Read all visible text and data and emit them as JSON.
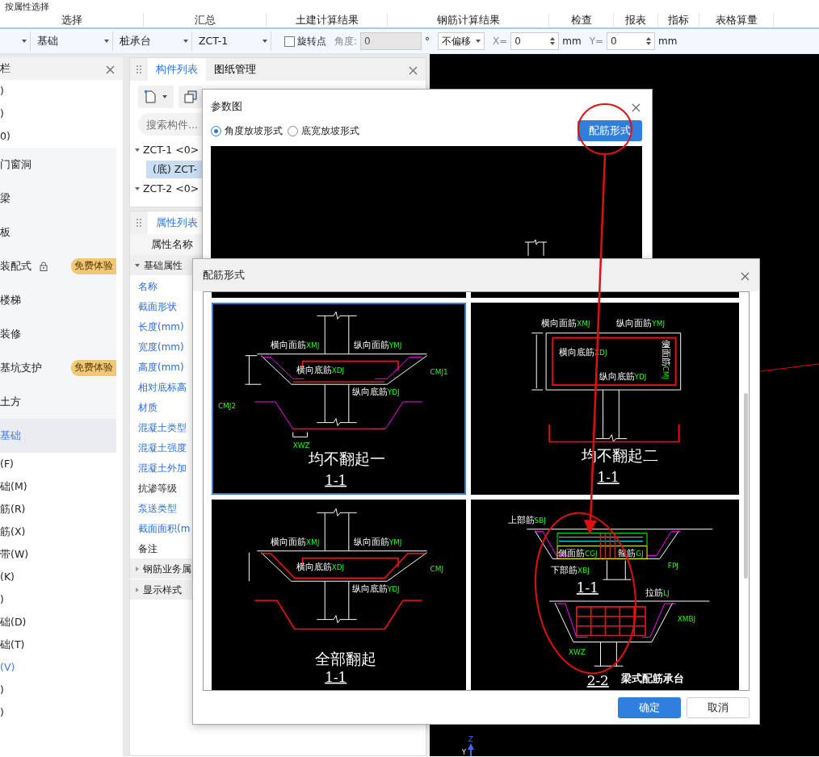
{
  "top_link": {
    "label": "按属性选择"
  },
  "ribbon_groups": [
    "选择",
    "汇总",
    "土建计算结果",
    "钢筋计算结果",
    "检查",
    "报表",
    "指标",
    "表格算量"
  ],
  "toolbar": {
    "dropdowns": [
      "基础",
      "桩承台",
      "ZCT-1"
    ],
    "rotate_point": {
      "label": "旋转点",
      "checked": false
    },
    "angle": {
      "label": "角度:",
      "value": "0",
      "unit": "°",
      "disabled": true
    },
    "offset": {
      "value": "不偏移"
    },
    "coords": [
      {
        "label": "X=",
        "value": "0",
        "unit": "mm"
      },
      {
        "label": "Y=",
        "value": "0",
        "unit": "mm"
      }
    ]
  },
  "left_panel": {
    "title": "栏",
    "items": [
      {
        "text": ")",
        "kind": "plain",
        "selected": false
      },
      {
        "text": ")",
        "kind": "plain",
        "selected": false
      },
      {
        "text": "0)",
        "kind": "plain",
        "selected": false
      },
      {
        "text": "门窗洞",
        "kind": "category",
        "selected": false
      },
      {
        "text": "梁",
        "kind": "category",
        "selected": false
      },
      {
        "text": "板",
        "kind": "category",
        "selected": false
      },
      {
        "text": "装配式",
        "kind": "category",
        "selected": false,
        "locked": true,
        "badge": "免费体验"
      },
      {
        "text": "楼梯",
        "kind": "category",
        "selected": false
      },
      {
        "text": "装修",
        "kind": "category",
        "selected": false
      },
      {
        "text": "基坑支护",
        "kind": "category",
        "selected": false,
        "badge": "免费体验"
      },
      {
        "text": "土方",
        "kind": "category",
        "selected": false
      },
      {
        "text": "基础",
        "kind": "category",
        "selected": true
      },
      {
        "text": "(F)",
        "kind": "plain",
        "selected": false
      },
      {
        "text": "础(M)",
        "kind": "plain",
        "selected": false
      },
      {
        "text": "筋(R)",
        "kind": "plain",
        "selected": false
      },
      {
        "text": "筋(X)",
        "kind": "plain",
        "selected": false
      },
      {
        "text": "带(W)",
        "kind": "plain",
        "selected": false
      },
      {
        "text": "(K)",
        "kind": "plain",
        "selected": false
      },
      {
        "text": ")",
        "kind": "plain",
        "selected": false
      },
      {
        "text": "础(D)",
        "kind": "plain",
        "selected": false
      },
      {
        "text": "础(T)",
        "kind": "plain",
        "selected": false
      },
      {
        "text": "(V)",
        "kind": "plain",
        "selected": true
      },
      {
        "text": ")",
        "kind": "plain",
        "selected": false
      },
      {
        "text": ")",
        "kind": "plain",
        "selected": false
      }
    ]
  },
  "component_panel": {
    "tabs": [
      {
        "label": "构件列表",
        "selected": true
      },
      {
        "label": "图纸管理",
        "selected": false
      }
    ],
    "search": {
      "placeholder": "搜索构件..."
    },
    "tree": [
      {
        "label": "ZCT-1 <0>",
        "expanded": true,
        "children": [
          {
            "label": "(底) ZCT-",
            "selected": true
          }
        ]
      },
      {
        "label": "ZCT-2 <0>",
        "expanded": true
      }
    ]
  },
  "property_panel": {
    "tab": {
      "label": "属性列表",
      "selected": true
    },
    "header": "属性名称",
    "groups": [
      {
        "label": "基础属性",
        "expanded": true,
        "items": [
          {
            "name": "名称",
            "public": true
          },
          {
            "name": "截面形状",
            "public": true
          },
          {
            "name": "长度(mm)",
            "public": true
          },
          {
            "name": "宽度(mm)",
            "public": true
          },
          {
            "name": "高度(mm)",
            "public": true
          },
          {
            "name": "相对底标高",
            "public": true
          },
          {
            "name": "材质",
            "public": true
          },
          {
            "name": "混凝土类型",
            "public": true
          },
          {
            "name": "混凝土强度",
            "public": true
          },
          {
            "name": "混凝土外加",
            "public": true
          },
          {
            "name": "抗渗等级",
            "public": false
          },
          {
            "name": "泵送类型",
            "public": true
          },
          {
            "name": "截面面积(m",
            "public": true
          },
          {
            "name": "备注",
            "public": false
          }
        ]
      },
      {
        "label": "钢筋业务属",
        "expanded": false
      },
      {
        "label": "显示样式",
        "expanded": false
      }
    ]
  },
  "canvas": {
    "axis_labels": [
      "Z",
      "Y"
    ]
  },
  "param_dialog": {
    "title": "参数图",
    "radios": [
      {
        "label": "角度放坡形式",
        "selected": true
      },
      {
        "label": "底宽放坡形式",
        "selected": false
      }
    ],
    "button": "配筋形式"
  },
  "rebar_dialog": {
    "title": "配筋形式",
    "panels": [
      {
        "kind": "slope",
        "selected": true,
        "caption": "均不翻起一",
        "sections": [
          "1-1"
        ],
        "labels": [
          {
            "text": "横向面筋",
            "code": "XMJ"
          },
          {
            "text": "纵向面筋",
            "code": "YMJ"
          },
          {
            "text": "横向底筋",
            "code": "XDJ"
          },
          {
            "text": "纵向底筋",
            "code": "YDJ"
          },
          {
            "code": "CMJ2"
          },
          {
            "code": "CMJ1"
          },
          {
            "code": "XWZ"
          }
        ]
      },
      {
        "kind": "box",
        "selected": false,
        "caption": "均不翻起二",
        "sections": [
          "1-1"
        ],
        "labels": [
          {
            "text": "横向面筋",
            "code": "XMJ"
          },
          {
            "text": "纵向面筋",
            "code": "YMJ"
          },
          {
            "text": "横向底筋",
            "code": "XDJ"
          },
          {
            "text": "纵向底筋",
            "code": "YDJ"
          },
          {
            "text": "侧面筋",
            "code": "CMJ"
          }
        ]
      },
      {
        "kind": "slope_up",
        "selected": false,
        "caption": "全部翻起",
        "sections": [
          "1-1"
        ],
        "labels": [
          {
            "text": "横向面筋",
            "code": "XMJ"
          },
          {
            "text": "纵向面筋",
            "code": "YMJ"
          },
          {
            "text": "横向底筋",
            "code": "XDJ"
          },
          {
            "text": "纵向底筋",
            "code": "YDJ"
          },
          {
            "code": "CMJ"
          }
        ]
      },
      {
        "kind": "beam",
        "selected": false,
        "caption": "梁式配筋承台",
        "sections": [
          "1-1",
          "2-2"
        ],
        "labels": [
          {
            "text": "上部筋",
            "code": "SBJ"
          },
          {
            "text": "侧面筋",
            "code": "CGJ"
          },
          {
            "text": "箍筋",
            "code": "GJ"
          },
          {
            "text": "下部筋",
            "code": "XBJ"
          },
          {
            "code": "FPJ"
          },
          {
            "text": "拉筋",
            "code": "LJ"
          },
          {
            "code": "XMBJ"
          },
          {
            "code": "XWZ"
          }
        ]
      }
    ],
    "buttons": [
      {
        "label": "确定",
        "primary": true
      },
      {
        "label": "取消",
        "primary": false
      }
    ]
  }
}
